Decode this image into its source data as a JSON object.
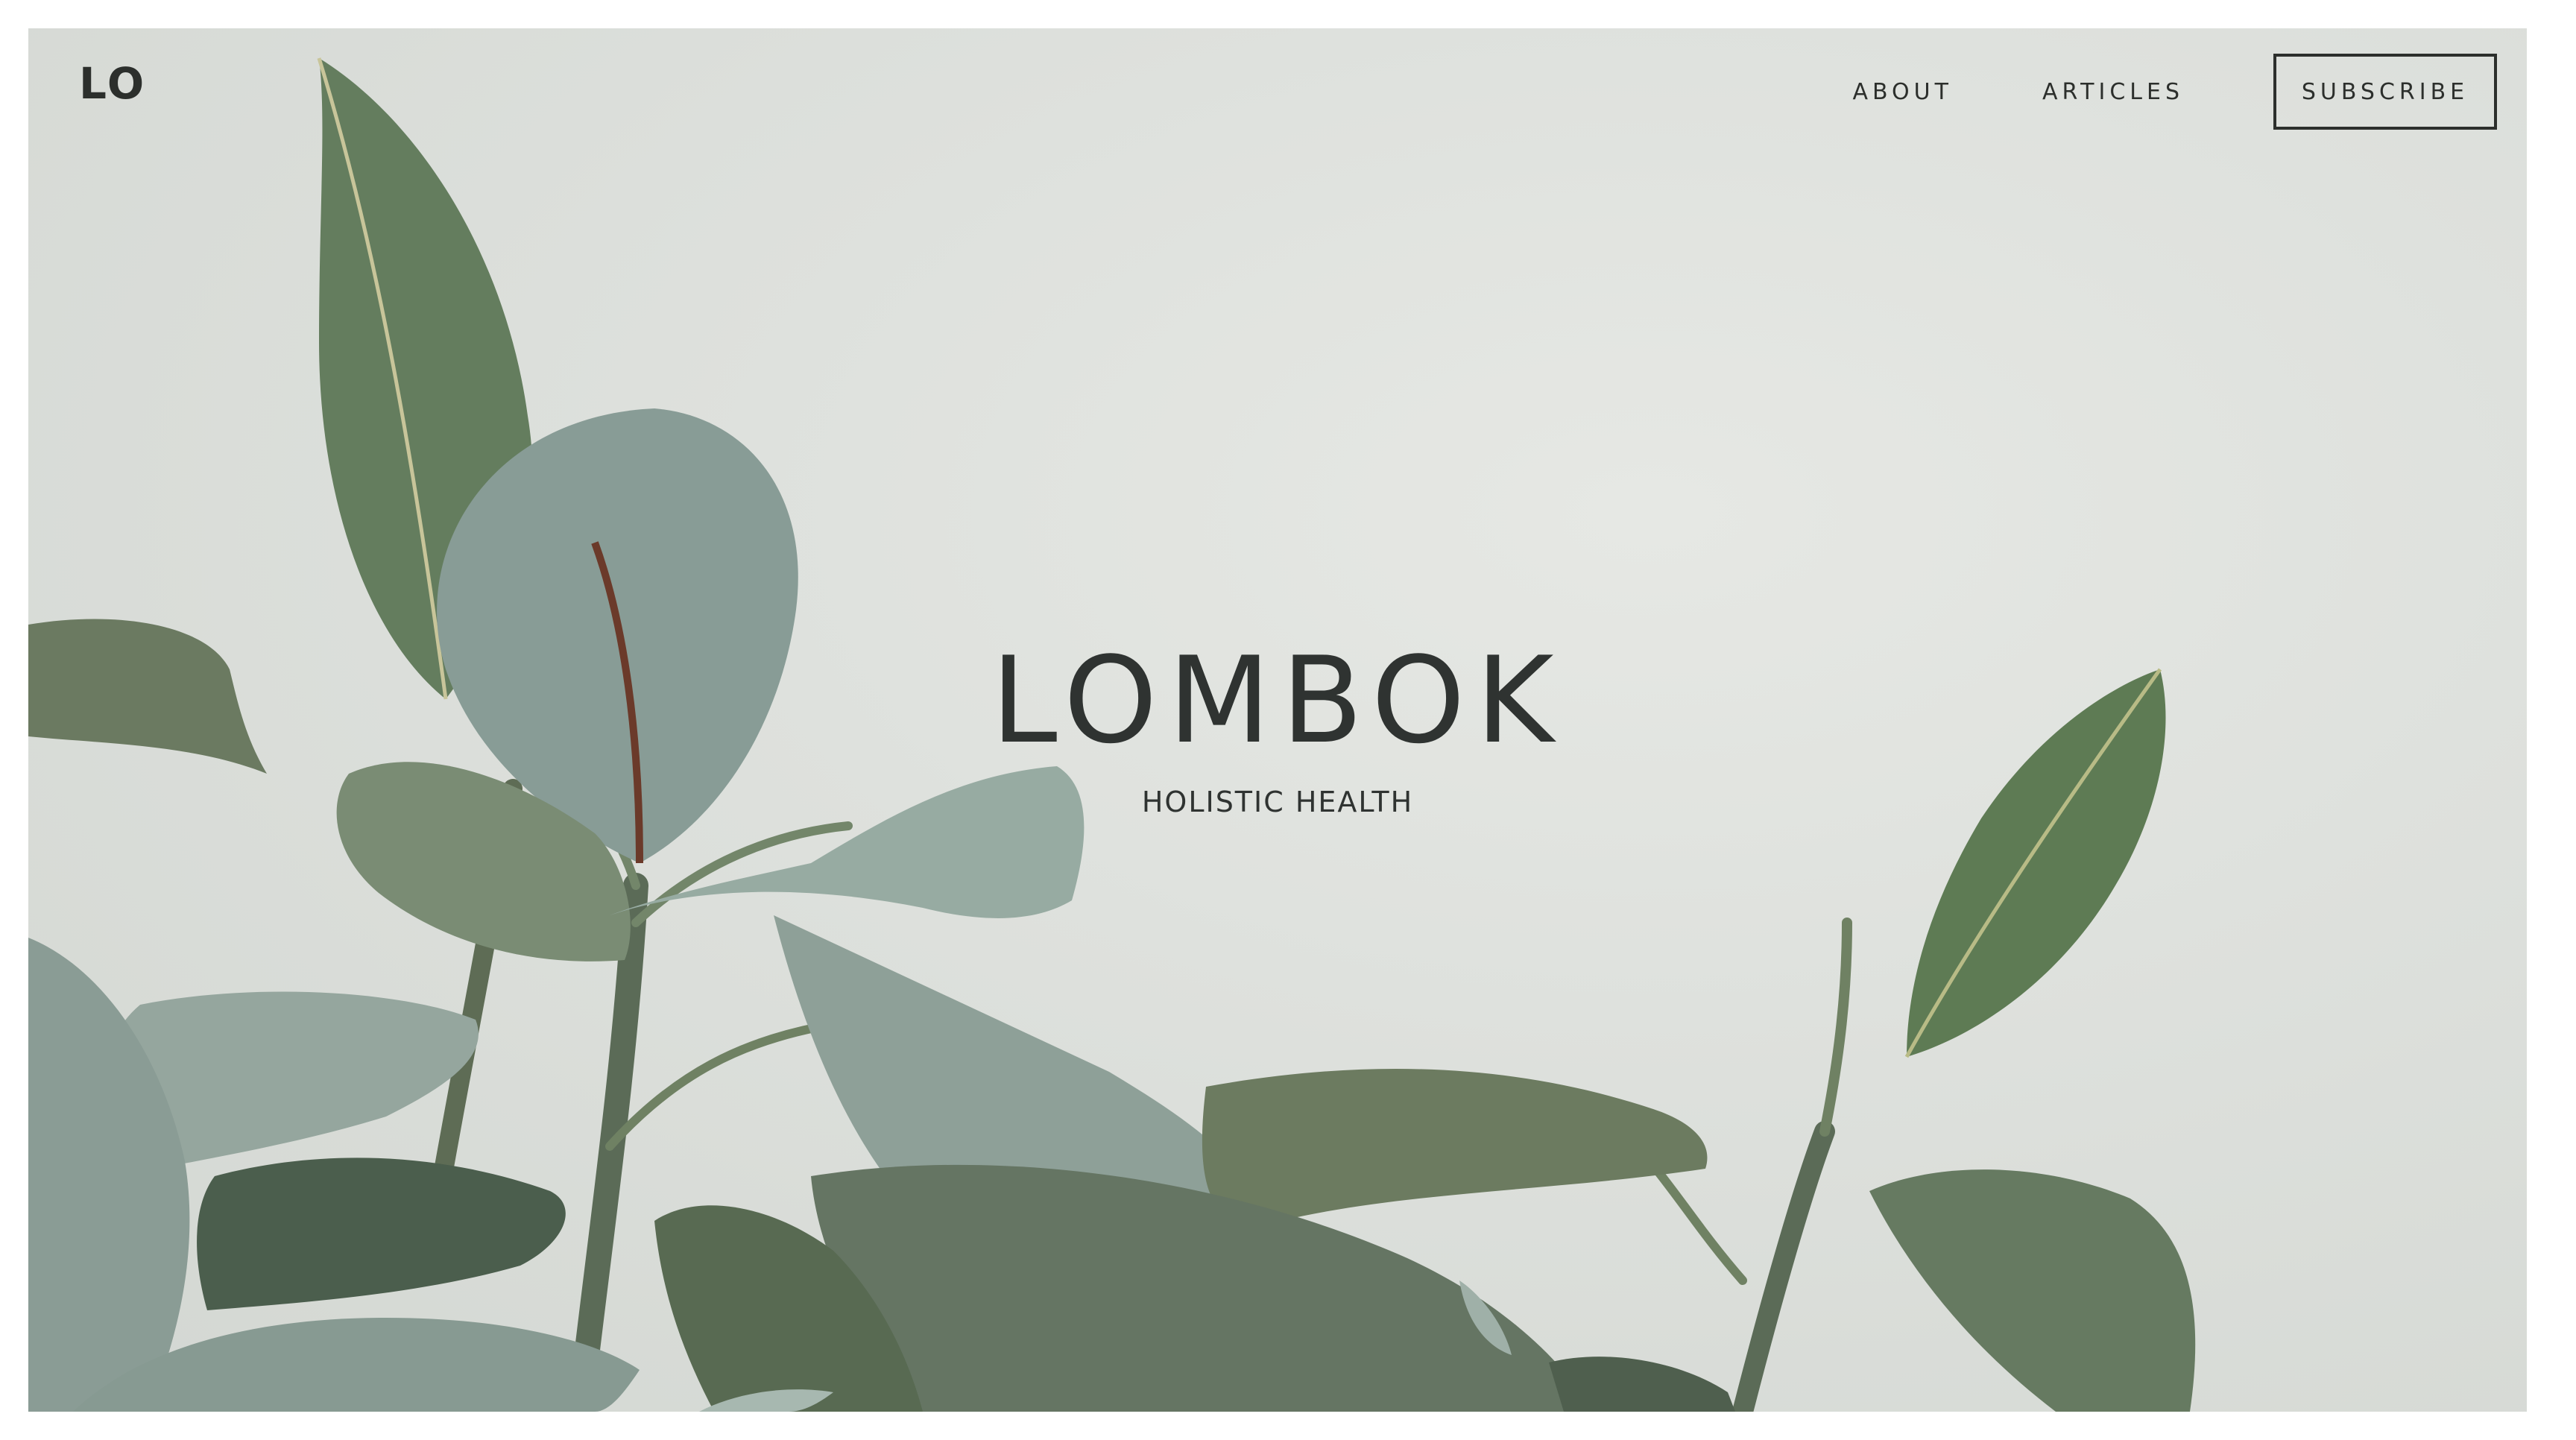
{
  "header": {
    "logo": "LO",
    "nav": [
      {
        "label": "ABOUT"
      },
      {
        "label": "ARTICLES"
      }
    ],
    "subscribe_label": "SUBSCRIBE"
  },
  "hero": {
    "title": "LOMBOK",
    "subtitle": "HOLISTIC HEALTH",
    "background_image": "rubber-plant-leaves"
  },
  "colors": {
    "text": "#2c2f2c",
    "background": "#dde0dc",
    "leaf_dark": "#5f7560",
    "leaf_light": "#9fb2aa"
  }
}
